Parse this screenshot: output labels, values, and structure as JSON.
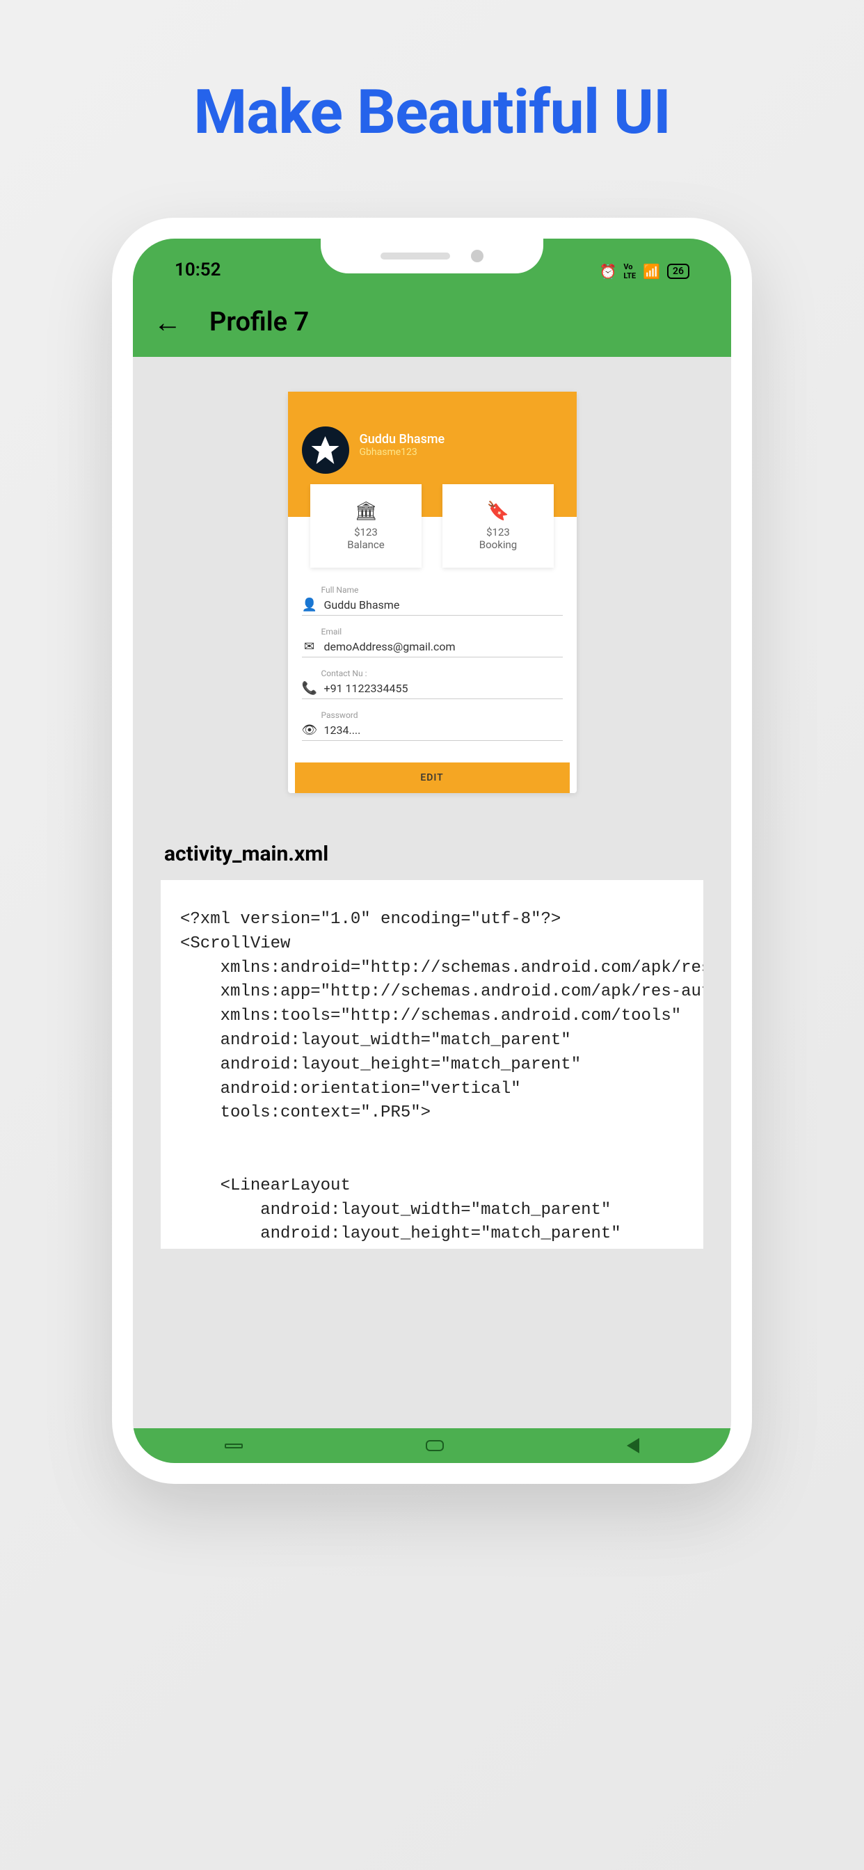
{
  "headline": "Make Beautiful UI",
  "status": {
    "time": "10:52",
    "alarm": "⏰",
    "volte": "VoLTE",
    "signal": "📶",
    "battery": "26"
  },
  "appbar": {
    "title": "Profile 7"
  },
  "profile": {
    "name": "Guddu Bhasme",
    "username": "Gbhasme123"
  },
  "stats": {
    "balance": {
      "value": "$123",
      "label": "Balance"
    },
    "booking": {
      "value": "$123",
      "label": "Booking"
    }
  },
  "form": {
    "fullname": {
      "label": "Full Name",
      "value": "Guddu Bhasme"
    },
    "email": {
      "label": "Email",
      "value": "demoAddress@gmail.com"
    },
    "contact": {
      "label": "Contact Nu :",
      "value": "+91 1122334455"
    },
    "password": {
      "label": "Password",
      "value": "1234...."
    }
  },
  "editButton": "EDIT",
  "codeTitle": "activity_main.xml",
  "codeContent": "<?xml version=\"1.0\" encoding=\"utf-8\"?>\n<ScrollView\n    xmlns:android=\"http://schemas.android.com/apk/res/a\n    xmlns:app=\"http://schemas.android.com/apk/res-auto\"\n    xmlns:tools=\"http://schemas.android.com/tools\"\n    android:layout_width=\"match_parent\"\n    android:layout_height=\"match_parent\"\n    android:orientation=\"vertical\"\n    tools:context=\".PR5\">\n\n\n    <LinearLayout\n        android:layout_width=\"match_parent\"\n        android:layout_height=\"match_parent\""
}
